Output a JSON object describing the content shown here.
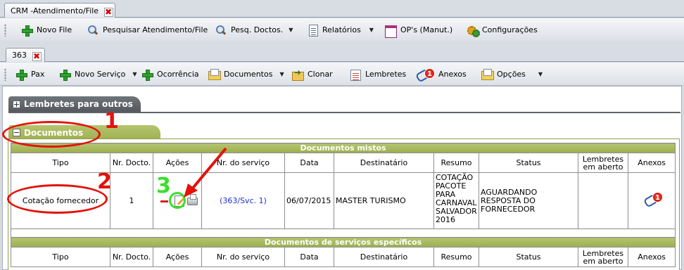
{
  "window": {
    "tab_label": "CRM -Atendimento/File",
    "close_symbol": "✖"
  },
  "main_toolbar": {
    "items": [
      {
        "label": "Novo File",
        "icon": "plus-icon"
      },
      {
        "label": "Pesquisar Atendimento/File",
        "icon": "search-icon"
      },
      {
        "label": "Pesq. Doctos.",
        "icon": "search-icon"
      },
      {
        "label": "Relatórios",
        "icon": "document-icon"
      },
      {
        "label": "OP's (Manut.)",
        "icon": "window-icon"
      },
      {
        "label": "Configurações",
        "icon": "gear-icon"
      }
    ]
  },
  "file_tab": {
    "label": "363",
    "close_symbol": "✖"
  },
  "file_toolbar": {
    "pax": "Pax",
    "novo_servico": "Novo Serviço",
    "ocorrencia": "Ocorrência",
    "documentos": "Documentos",
    "clonar": "Clonar",
    "lembretes": "Lembretes",
    "anexos": "Anexos",
    "anexos_badge": "1",
    "opcoes": "Opções"
  },
  "panels": {
    "lembretes_outros": "Lembretes para outros",
    "documentos": "Documentos"
  },
  "colors": {
    "panel_dark": "#5f6469",
    "panel_green": "#a3b35a",
    "annotation_red": "#e3120b",
    "annotation_green": "#38e02a",
    "link_blue": "#1b2fd0"
  },
  "mistos": {
    "title": "Documentos mistos",
    "headers": [
      "Tipo",
      "Nr. Docto.",
      "Ações",
      "Nr. do serviço",
      "Data",
      "Destinatário",
      "Resumo",
      "Status",
      "Lembretes em aberto",
      "Anexos"
    ],
    "row": {
      "tipo": "Cotação fornecedor",
      "nr_docto": "1",
      "nr_servico": "(363/Svc. 1)",
      "data": "06/07/2015",
      "destinatario": "MASTER TURISMO",
      "resumo": "COTAÇÃO PACOTE PARA CARNAVAL SALVADOR 2016",
      "status": "AGUARDANDO RESPOSTA DO FORNECEDOR",
      "lembretes": "",
      "anexos_badge": "1"
    }
  },
  "especificos": {
    "title": "Documentos de serviços específicos",
    "headers": [
      "Tipo",
      "Nr. Docto.",
      "Ações",
      "Nr. do serviço",
      "Data",
      "Destinatário",
      "Resumo",
      "Status",
      "Lembretes em aberto",
      "Anexos"
    ]
  },
  "annotations": {
    "n1": "1",
    "n2": "2",
    "n3": "3"
  }
}
